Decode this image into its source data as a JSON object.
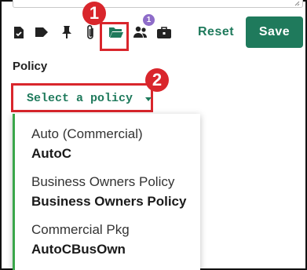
{
  "toolbar": {
    "icons": [
      "document-check-icon",
      "tag-icon",
      "pin-icon",
      "paperclip-icon",
      "folder-open-icon",
      "users-icon",
      "briefcase-icon"
    ],
    "users_badge": "1",
    "reset_label": "Reset",
    "save_label": "Save"
  },
  "callouts": {
    "first": "1",
    "second": "2"
  },
  "policy": {
    "label": "Policy",
    "select_label": "Select a policy",
    "options": [
      {
        "title": "Auto (Commercial)",
        "code": "AutoC"
      },
      {
        "title": "Business Owners Policy",
        "code": "Business Owners Policy"
      },
      {
        "title": "Commercial Pkg",
        "code": "AutoCBusOwn"
      }
    ]
  },
  "colors": {
    "accent": "#1f7a5c",
    "callout": "#d9262c",
    "badge": "#8e6cc9",
    "option_bar": "#3aa64a"
  }
}
